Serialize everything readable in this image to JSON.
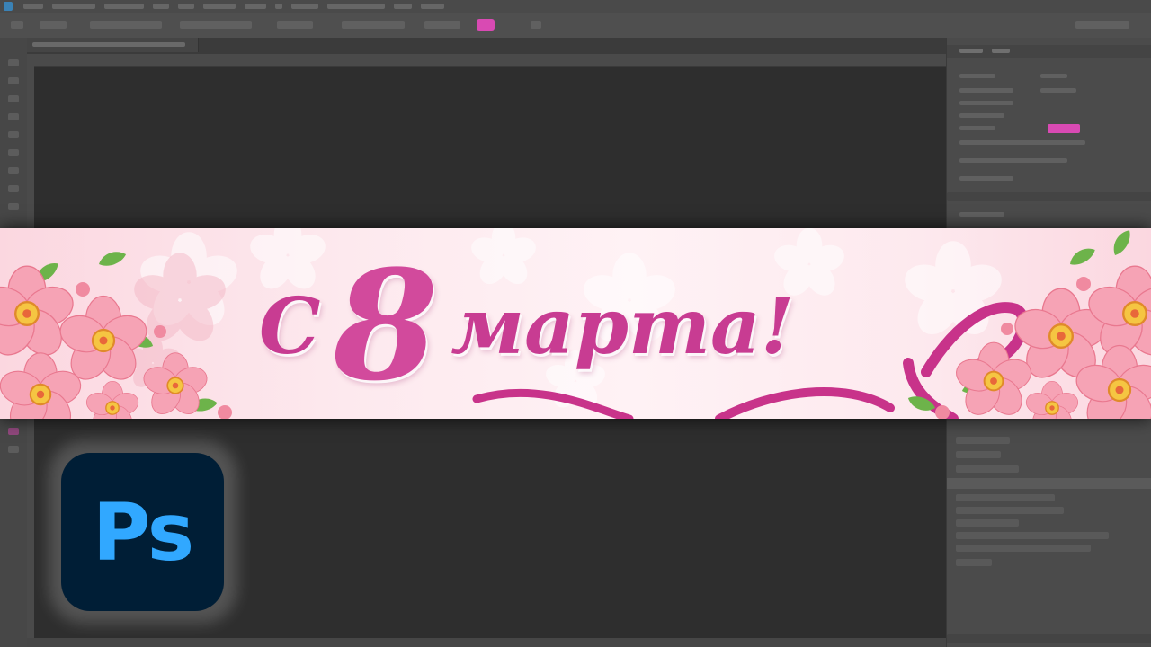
{
  "banner": {
    "greeting_prefix": "С",
    "greeting_number": "8",
    "greeting_word": "марта!",
    "colors": {
      "text": "#c83c92",
      "number": "#d24a9c",
      "ribbon": "#c8338a",
      "petal": "#f7a9b8",
      "flower_center": "#f5c542",
      "leaf": "#6db34a"
    }
  },
  "logo": {
    "text": "Ps",
    "text_color": "#31a8ff",
    "background": "#001e36"
  },
  "app": {
    "accent_color": "#d94ab3"
  }
}
